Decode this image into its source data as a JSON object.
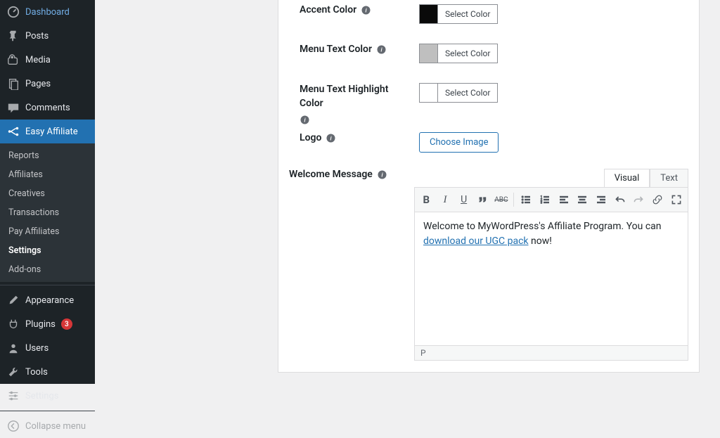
{
  "sidebar": {
    "top": [
      {
        "id": "dashboard",
        "label": "Dashboard",
        "icon": "dashboard"
      },
      {
        "id": "posts",
        "label": "Posts",
        "icon": "pin"
      },
      {
        "id": "media",
        "label": "Media",
        "icon": "media"
      },
      {
        "id": "pages",
        "label": "Pages",
        "icon": "pages"
      },
      {
        "id": "comments",
        "label": "Comments",
        "icon": "comment"
      }
    ],
    "active": {
      "id": "easy-affiliate",
      "label": "Easy Affiliate",
      "icon": "affiliate"
    },
    "sub": [
      {
        "label": "Reports"
      },
      {
        "label": "Affiliates"
      },
      {
        "label": "Creatives"
      },
      {
        "label": "Transactions"
      },
      {
        "label": "Pay Affiliates"
      },
      {
        "label": "Settings",
        "current": true
      },
      {
        "label": "Add-ons"
      }
    ],
    "bottom": [
      {
        "id": "appearance",
        "label": "Appearance",
        "icon": "brush"
      },
      {
        "id": "plugins",
        "label": "Plugins",
        "icon": "plug",
        "badge": "3"
      },
      {
        "id": "users",
        "label": "Users",
        "icon": "user"
      },
      {
        "id": "tools",
        "label": "Tools",
        "icon": "wrench"
      },
      {
        "id": "settings",
        "label": "Settings",
        "icon": "sliders"
      }
    ],
    "collapse": "Collapse menu"
  },
  "fields": {
    "accent": {
      "label": "Accent Color",
      "btn": "Select Color",
      "swatch": "#0a0a0a"
    },
    "menu_text": {
      "label": "Menu Text Color",
      "btn": "Select Color",
      "swatch": "#bfbfbf"
    },
    "menu_hl": {
      "label": "Menu Text Highlight Color",
      "btn": "Select Color",
      "swatch": "#ffffff"
    },
    "logo": {
      "label": "Logo",
      "btn": "Choose Image"
    },
    "welcome": {
      "label": "Welcome Message"
    }
  },
  "editor": {
    "tabs": {
      "visual": "Visual",
      "text": "Text"
    },
    "content_pre": "Welcome to MyWordPress's Affiliate Program. You can ",
    "content_link": "download our UGC pack",
    "content_post": " now!",
    "status": "P"
  }
}
